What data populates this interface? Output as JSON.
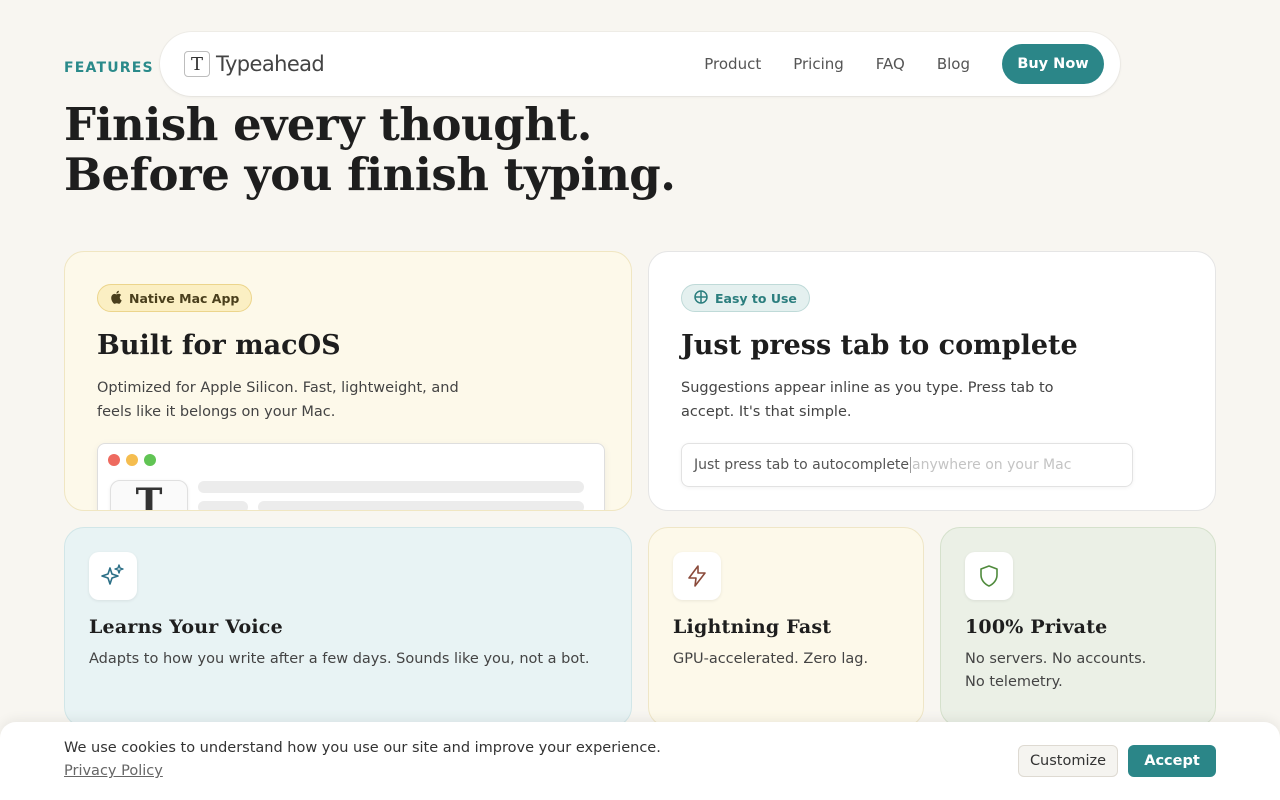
{
  "header": {
    "eyebrow": "FEATURES",
    "logo_text": "Typeahead",
    "logo_mark": "T",
    "nav": [
      "Product",
      "Pricing",
      "FAQ",
      "Blog"
    ],
    "buy_label": "Buy Now"
  },
  "hero": {
    "line1": "Finish every thought.",
    "line2": "Before you finish typing."
  },
  "cards": {
    "mac": {
      "badge": "Native Mac App",
      "badge_icon": "apple-icon",
      "title": "Built for macOS",
      "desc": "Optimized for Apple Silicon. Fast, lightweight, and feels like it belongs on your Mac.",
      "app_icon_letter": "T"
    },
    "tab": {
      "badge": "Easy to Use",
      "badge_icon": "crosshair-icon",
      "title": "Just press tab to complete",
      "desc": "Suggestions appear inline as you type. Press tab to accept. It's that simple.",
      "typed": "Just press tab to autocomplete",
      "suggestion": " anywhere on your Mac"
    }
  },
  "features": [
    {
      "icon": "sparkles-icon",
      "title": "Learns Your Voice",
      "desc": "Adapts to how you write after a few days. Sounds like you, not a bot."
    },
    {
      "icon": "lightning-icon",
      "title": "Lightning Fast",
      "desc": "GPU-accelerated. Zero lag."
    },
    {
      "icon": "shield-icon",
      "title": "100% Private",
      "desc_line1": "No servers. No accounts.",
      "desc_line2": "No telemetry."
    }
  ],
  "cookie": {
    "text": "We use cookies to understand how you use our site and improve your experience.",
    "link": "Privacy Policy",
    "customize": "Customize",
    "accept": "Accept"
  },
  "colors": {
    "accent": "#2b8688",
    "background": "#f8f6f1",
    "mac_card": "#fdf9ea",
    "voice_card": "#e8f3f4",
    "private_card": "#ebf0e6"
  }
}
